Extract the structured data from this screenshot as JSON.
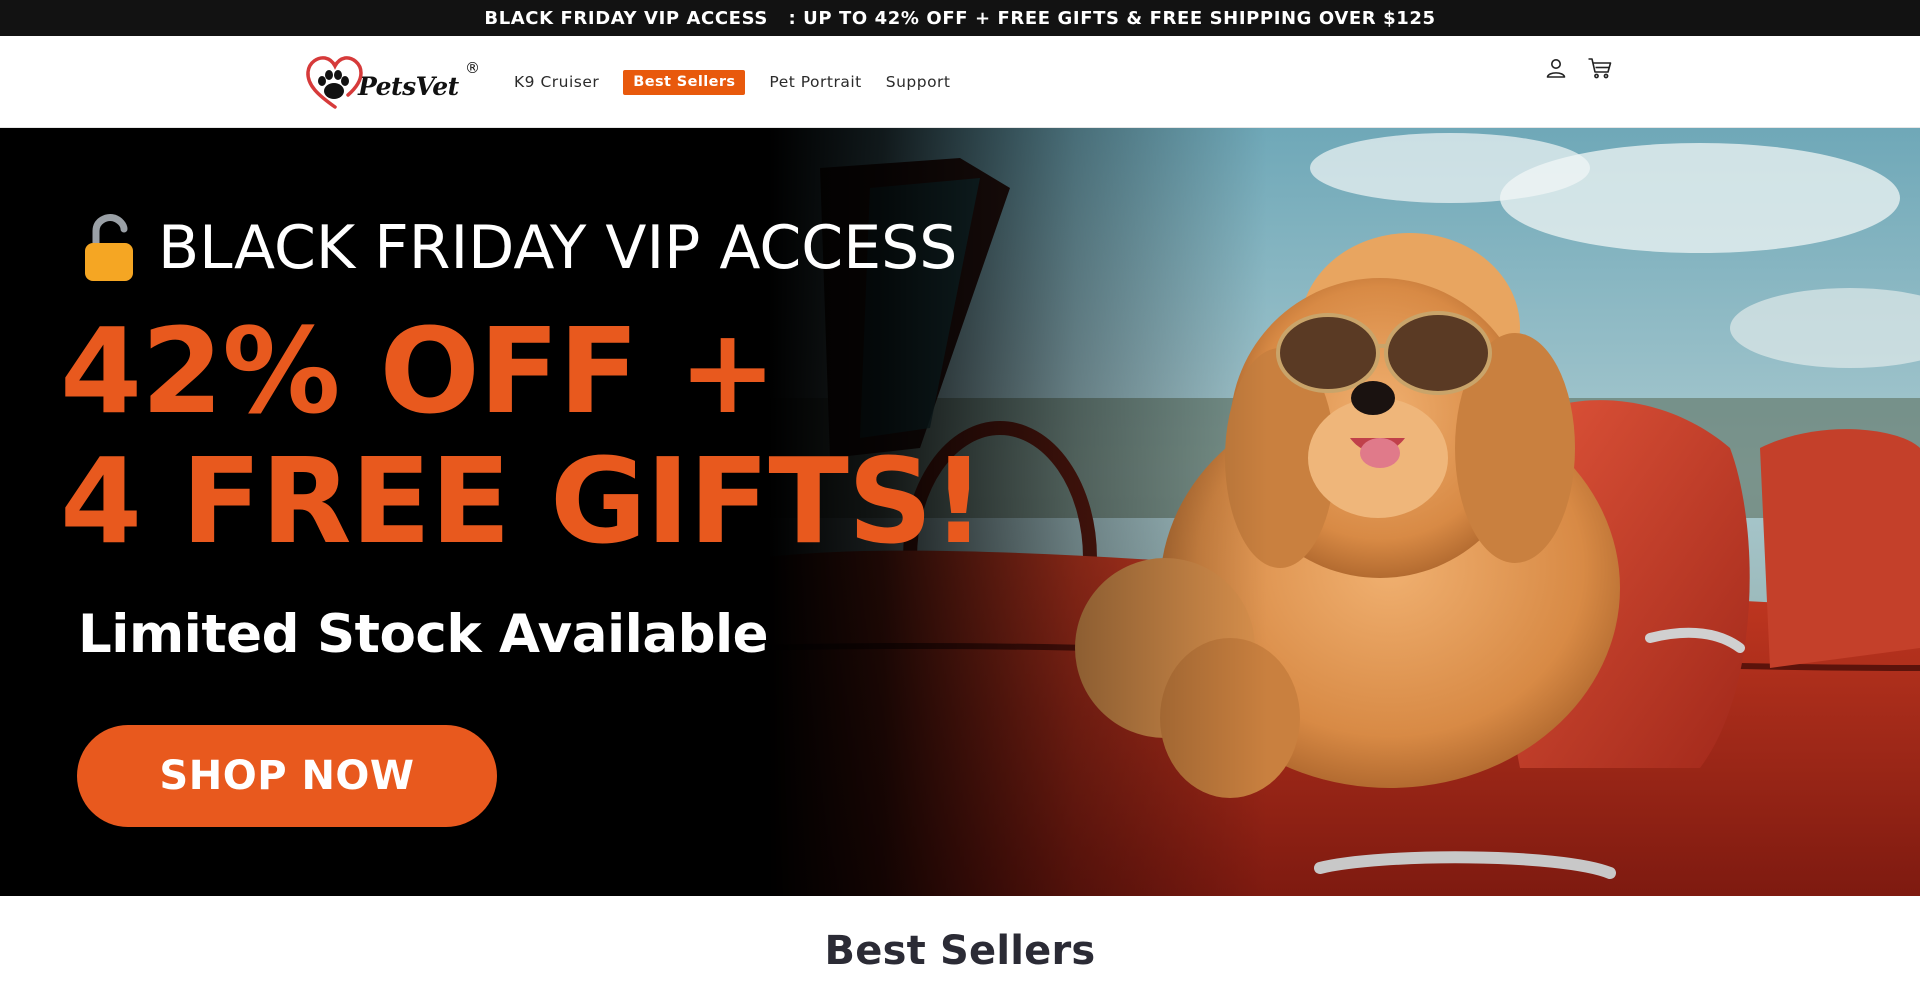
{
  "announcement": {
    "text": "BLACK FRIDAY VIP ACCESS   : UP TO 42% OFF + FREE GIFTS & FREE SHIPPING OVER $125"
  },
  "header": {
    "logo_text": "PetsVet",
    "logo_reg": "®",
    "nav": [
      {
        "label": "K9 Cruiser"
      },
      {
        "label": "Best Sellers",
        "highlighted": true
      },
      {
        "label": "Pet Portrait"
      },
      {
        "label": "Support"
      }
    ],
    "icons": [
      "account-icon",
      "cart-icon"
    ]
  },
  "hero": {
    "vip_text": "BLACK FRIDAY VIP ACCESS",
    "headline_line1": "42% OFF +",
    "headline_line2": "4 FREE GIFTS!",
    "subheadline": "Limited Stock Available",
    "cta_label": "SHOP NOW"
  },
  "section": {
    "title": "Best Sellers"
  },
  "colors": {
    "accent": "#e8591e",
    "badge": "#e8590c",
    "announcement_bg": "#121212",
    "hero_bg": "#000000"
  }
}
